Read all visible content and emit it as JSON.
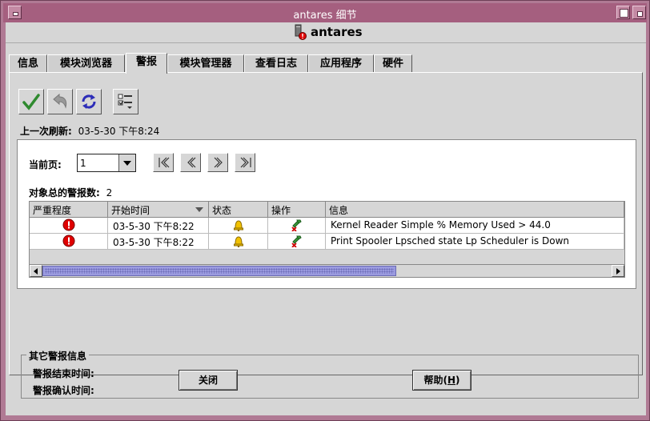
{
  "window": {
    "title": "antares 细节"
  },
  "header": {
    "host_name": "antares"
  },
  "tabs": [
    {
      "label": "信息"
    },
    {
      "label": "模块浏览器"
    },
    {
      "label": "警报"
    },
    {
      "label": "模块管理器"
    },
    {
      "label": "查看日志"
    },
    {
      "label": "应用程序"
    },
    {
      "label": "硬件"
    }
  ],
  "active_tab": "警报",
  "toolbar": {
    "icons": [
      "checkmark-icon",
      "undo-arrow-icon",
      "refresh-icon",
      "column-settings-icon"
    ]
  },
  "refresh": {
    "label": "上一次刷新:",
    "value": "03-5-30 下午8:24"
  },
  "pager": {
    "label": "当前页:",
    "value": "1"
  },
  "alarm_count": {
    "label": "对象总的警报数:",
    "value": "2"
  },
  "table": {
    "columns": [
      "严重程度",
      "开始时间",
      "状态",
      "操作",
      "信息"
    ],
    "rows": [
      {
        "start": "03-5-30 下午8:22",
        "message": "Kernel Reader Simple % Memory Used > 44.0"
      },
      {
        "start": "03-5-30 下午8:22",
        "message": "Print Spooler Lpsched state Lp Scheduler is Down"
      }
    ]
  },
  "other_info": {
    "title": "其它警报信息",
    "end_time_label": "警报结束时间:",
    "ack_time_label": "警报确认时间:"
  },
  "buttons": {
    "close": "关闭",
    "help_prefix": "帮助(",
    "help_mnemonic": "H",
    "help_suffix": ")"
  },
  "colors": {
    "titlebar": "#a55f7f",
    "frame": "#b07a94",
    "critical": "#e00000",
    "scroll_thumb": "#9a9adf"
  }
}
